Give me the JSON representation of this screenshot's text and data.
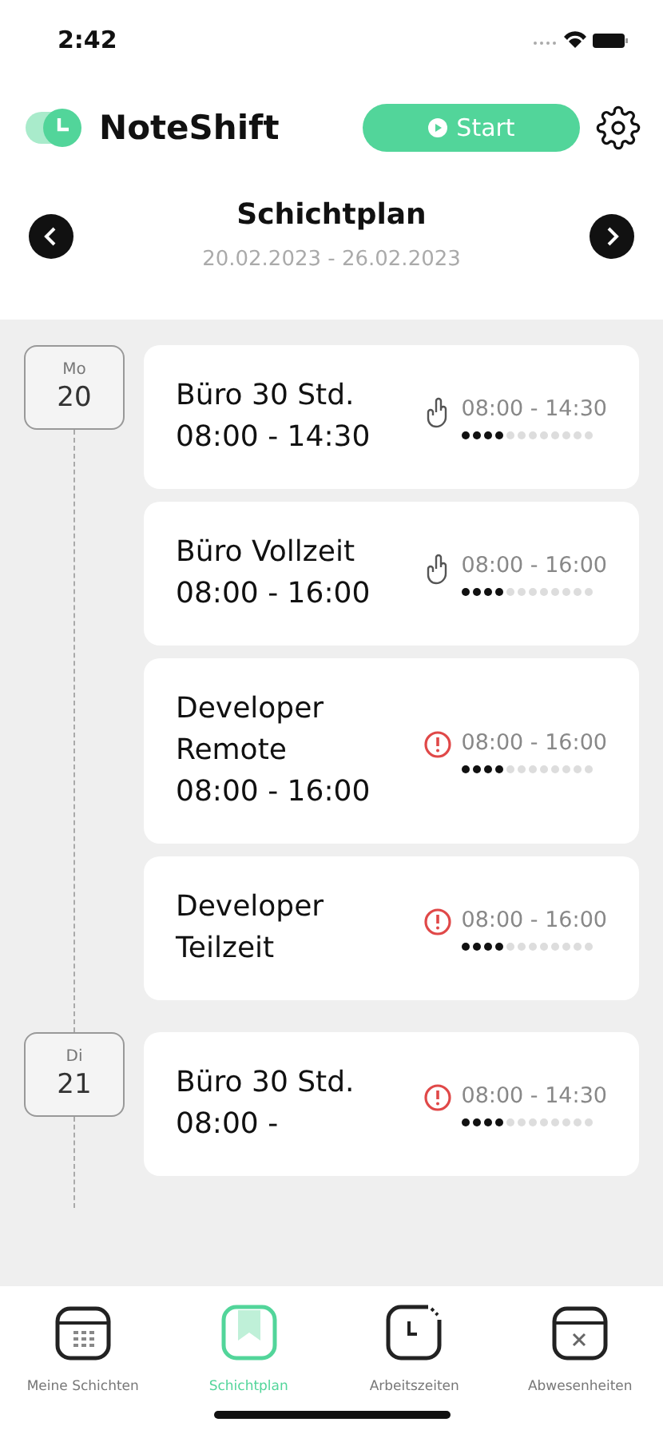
{
  "status_bar": {
    "time": "2:42"
  },
  "header": {
    "app_name": "NoteShift",
    "start_button": "Start"
  },
  "week": {
    "title": "Schichtplan",
    "range": "20.02.2023 - 26.02.2023"
  },
  "days": [
    {
      "weekday": "Mo",
      "date": "20",
      "shifts": [
        {
          "title": "Büro 30 Std. 08:00 - 14:30",
          "kind": "hand",
          "time": "08:00 - 14:30",
          "level": 0.33
        },
        {
          "title": "Büro Vollzeit 08:00 - 16:00",
          "kind": "hand",
          "time": "08:00 - 16:00",
          "level": 0.33
        },
        {
          "title": "Developer Remote 08:00 - 16:00",
          "kind": "alert",
          "time": "08:00 - 16:00",
          "level": 0.33
        },
        {
          "title": "Developer Teilzeit",
          "kind": "alert",
          "time": "08:00 - 16:00",
          "level": 0.33
        }
      ]
    },
    {
      "weekday": "Di",
      "date": "21",
      "shifts": [
        {
          "title": "Büro 30 Std. 08:00 -",
          "kind": "alert",
          "time": "08:00 - 14:30",
          "level": 0.33
        }
      ]
    }
  ],
  "tabs": [
    {
      "label": "Meine Schichten",
      "kind": "calendar",
      "selected": false
    },
    {
      "label": "Schichtplan",
      "kind": "bookmark",
      "selected": true
    },
    {
      "label": "Arbeitszeiten",
      "kind": "clock",
      "selected": false
    },
    {
      "label": "Abwesenheiten",
      "kind": "absence",
      "selected": false
    }
  ]
}
